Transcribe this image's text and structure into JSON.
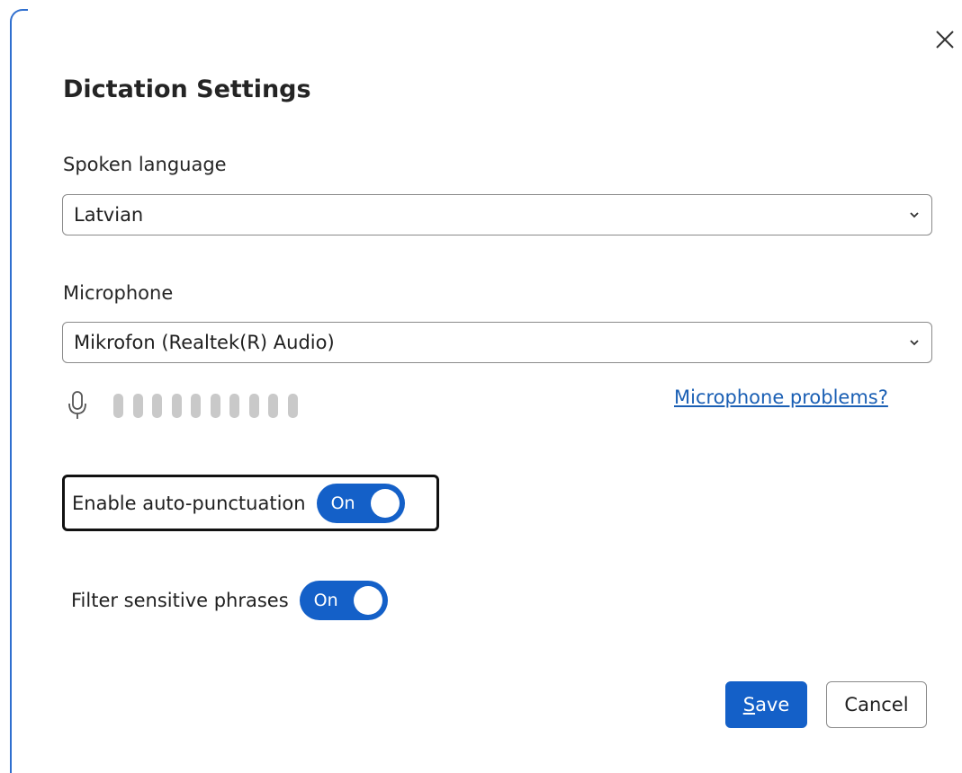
{
  "dialog": {
    "title": "Dictation Settings",
    "close_icon": "close-icon"
  },
  "language": {
    "label": "Spoken language",
    "value": "Latvian"
  },
  "microphone": {
    "label": "Microphone",
    "value": "Mikrofon (Realtek(R) Audio)",
    "level_icon": "microphone-icon",
    "level_bar_count": 10,
    "problems_link": "Microphone problems?"
  },
  "auto_punctuation": {
    "label": "Enable auto-punctuation",
    "state_label": "On",
    "on": true
  },
  "filter_phrases": {
    "label": "Filter sensitive phrases",
    "state_label": "On",
    "on": true
  },
  "buttons": {
    "save_first": "S",
    "save_rest": "ave",
    "cancel": "Cancel"
  },
  "colors": {
    "accent": "#1460c8",
    "link": "#1a5fb4",
    "level_bar": "#c9c9c9"
  }
}
